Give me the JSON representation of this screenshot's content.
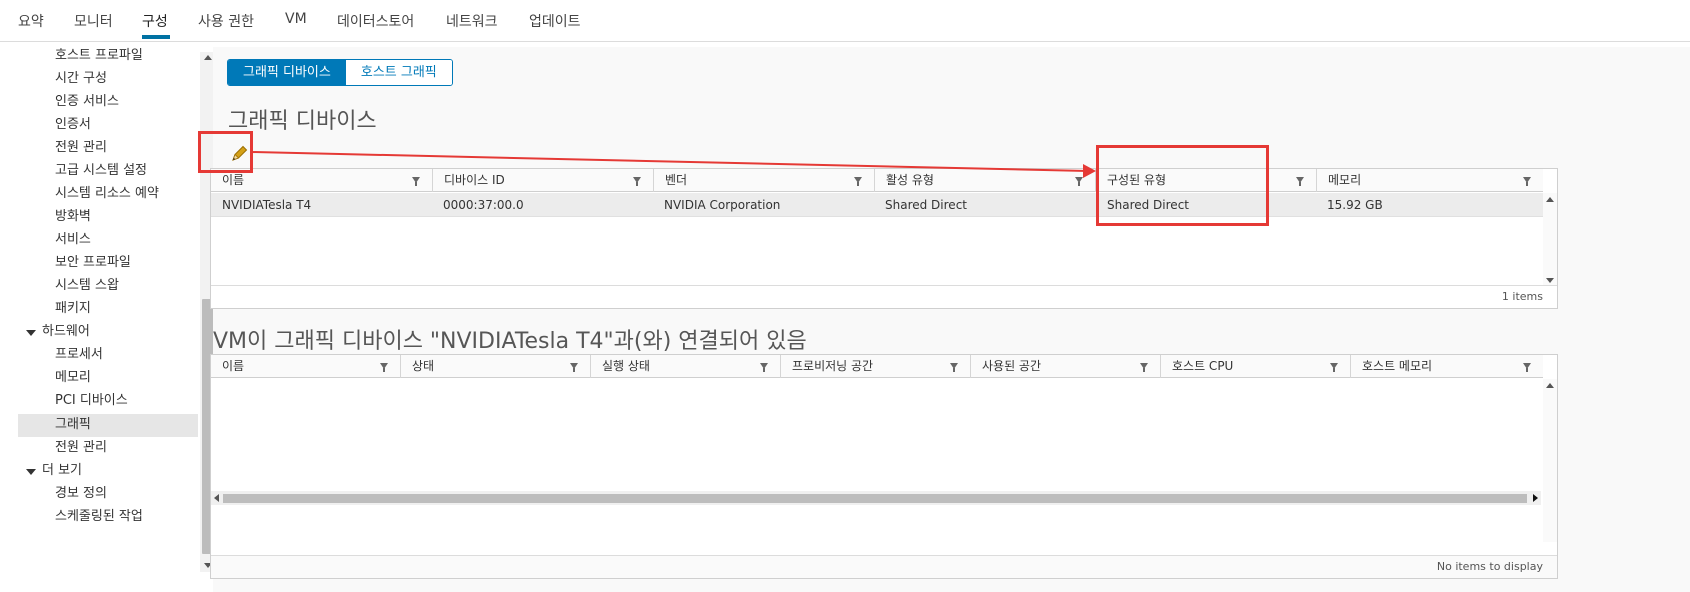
{
  "tabs": [
    {
      "label": "요약"
    },
    {
      "label": "모니터"
    },
    {
      "label": "구성"
    },
    {
      "label": "사용 권한"
    },
    {
      "label": "VM"
    },
    {
      "label": "데이터스토어"
    },
    {
      "label": "네트워크"
    },
    {
      "label": "업데이트"
    }
  ],
  "active_tab": "구성",
  "sidebar": {
    "items": [
      {
        "label": "호스트 프로파일"
      },
      {
        "label": "시간 구성"
      },
      {
        "label": "인증 서비스"
      },
      {
        "label": "인증서"
      },
      {
        "label": "전원 관리"
      },
      {
        "label": "고급 시스템 설정"
      },
      {
        "label": "시스템 리소스 예약"
      },
      {
        "label": "방화벽"
      },
      {
        "label": "서비스"
      },
      {
        "label": "보안 프로파일"
      },
      {
        "label": "시스템 스왑"
      },
      {
        "label": "패키지"
      },
      {
        "label": "하드웨어"
      },
      {
        "label": "프로세서"
      },
      {
        "label": "메모리"
      },
      {
        "label": "PCI 디바이스"
      },
      {
        "label": "그래픽"
      },
      {
        "label": "전원 관리"
      },
      {
        "label": "더 보기"
      },
      {
        "label": "경보 정의"
      },
      {
        "label": "스케줄링된 작업"
      }
    ],
    "selected": "그래픽"
  },
  "segmented": {
    "graphics_devices": "그래픽 디바이스",
    "host_graphics": "호스트 그래픽"
  },
  "devices_section": {
    "title": "그래픽 디바이스",
    "columns": [
      "이름",
      "디바이스 ID",
      "벤더",
      "활성 유형",
      "구성된 유형",
      "메모리"
    ],
    "rows": [
      [
        "NVIDIATesla T4",
        "0000:37:00.0",
        "NVIDIA Corporation",
        "Shared Direct",
        "Shared Direct",
        "15.92 GB"
      ]
    ],
    "footer": "1 items"
  },
  "vm_section": {
    "title": "VM이 그래픽 디바이스 \"NVIDIATesla T4\"과(와) 연결되어 있음",
    "columns": [
      "이름",
      "상태",
      "실행 상태",
      "프로비저닝 공간",
      "사용된 공간",
      "호스트 CPU",
      "호스트 메모리"
    ],
    "footer": "No items to display"
  },
  "icons": {
    "edit": "pencil-icon",
    "filter": "filter-icon"
  },
  "colors": {
    "accent": "#0079b8",
    "annotation": "#e53935"
  }
}
